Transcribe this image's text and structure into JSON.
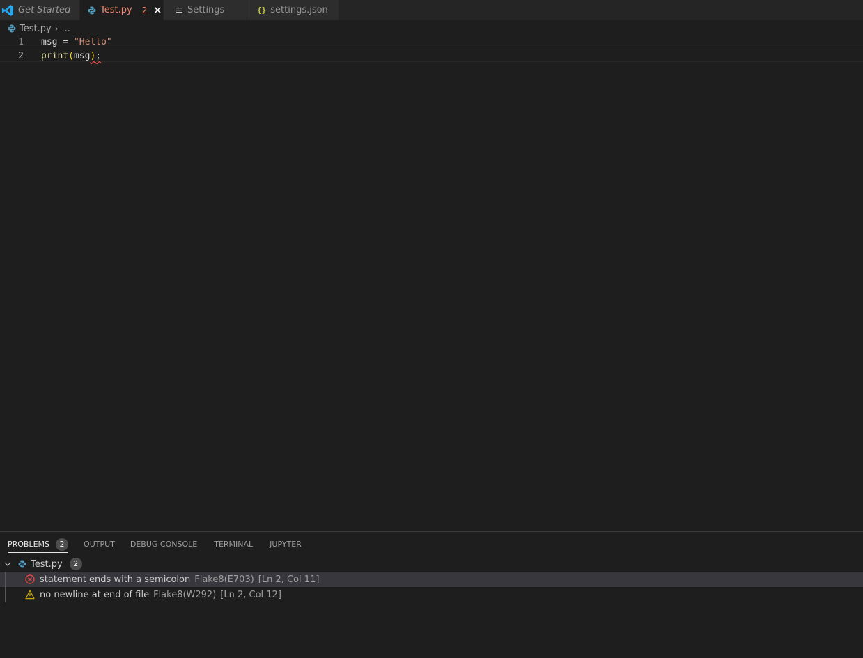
{
  "tabs": [
    {
      "label": "Get Started",
      "icon": "vscode-logo-icon"
    },
    {
      "label": "Test.py",
      "icon": "python-icon",
      "badge": "2",
      "close": "✕"
    },
    {
      "label": "Settings",
      "icon": "settings-lines-icon"
    },
    {
      "label": "settings.json",
      "icon": "json-braces-icon",
      "icon_text": "{}"
    }
  ],
  "breadcrumb": {
    "file": "Test.py",
    "separator": "›",
    "more": "..."
  },
  "editor": {
    "lines": [
      {
        "number": "1",
        "tokens": [
          "msg",
          " = ",
          "\"Hello\""
        ]
      },
      {
        "number": "2",
        "tokens": [
          "print",
          "(",
          "msg",
          ")",
          ";"
        ]
      }
    ]
  },
  "panel": {
    "tabs": [
      {
        "label": "PROBLEMS",
        "badge": "2"
      },
      {
        "label": "OUTPUT"
      },
      {
        "label": "DEBUG CONSOLE"
      },
      {
        "label": "TERMINAL"
      },
      {
        "label": "JUPYTER"
      }
    ],
    "file": {
      "label": "Test.py",
      "count": "2"
    },
    "problems": [
      {
        "severity": "error",
        "icon": "error-circle-icon",
        "message": "statement ends with a semicolon",
        "source": "Flake8(E703)",
        "location": "[Ln 2, Col 11]"
      },
      {
        "severity": "warning",
        "icon": "warning-triangle-icon",
        "message": "no newline at end of file",
        "source": "Flake8(W292)",
        "location": "[Ln 2, Col 12]"
      }
    ]
  },
  "colors": {
    "editor_bg": "#1e1e1e",
    "tabbar_bg": "#252526",
    "error": "#f14c4c",
    "warning": "#cca700",
    "python_blue": "#519aba",
    "vscode_blue": "#23a9f2",
    "json_yellow": "#cbcb41"
  }
}
